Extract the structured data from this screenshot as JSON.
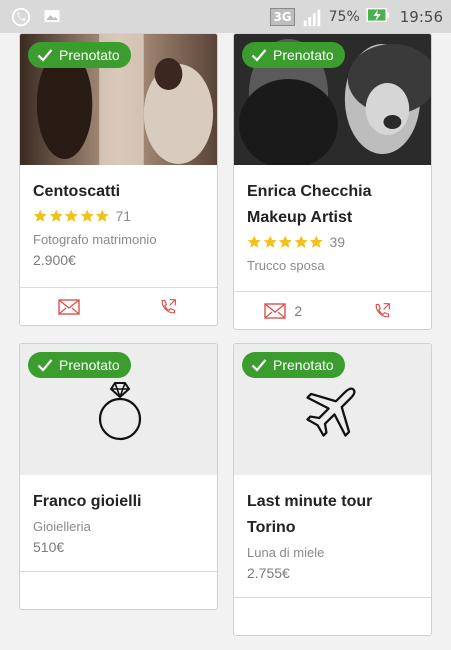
{
  "status_bar": {
    "network": "3G",
    "battery": "75%",
    "time": "19:56"
  },
  "badge_label": "Prenotato",
  "cards": [
    {
      "name_lines": [
        "Centoscatti"
      ],
      "rating": 5,
      "reviews": "71",
      "category": "Fotografo matrimonio",
      "price": "2.900€",
      "message_count": ""
    },
    {
      "name_lines": [
        "Enrica Checchia",
        "Makeup Artist"
      ],
      "rating": 5,
      "reviews": "39",
      "category": "Trucco sposa",
      "price": "",
      "message_count": "2"
    },
    {
      "name_lines": [
        "Franco gioielli"
      ],
      "category": "Gioielleria",
      "price": "510€",
      "icon": "ring-icon"
    },
    {
      "name_lines": [
        "Last minute tour",
        "Torino"
      ],
      "category": "Luna di miele",
      "price": "2.755€",
      "icon": "airplane-icon"
    }
  ],
  "colors": {
    "badge": "#3a9d2e",
    "star": "#f1c21b",
    "action_icon": "#d9534f"
  }
}
